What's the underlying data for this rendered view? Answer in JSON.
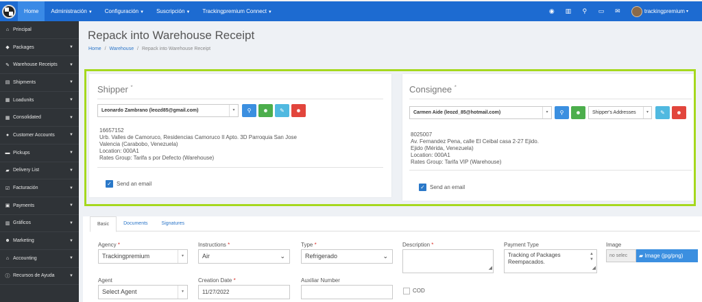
{
  "topbar": {
    "nav": [
      {
        "label": "Home",
        "active": true,
        "caret": false
      },
      {
        "label": "Administración",
        "active": false,
        "caret": true
      },
      {
        "label": "Configuración",
        "active": false,
        "caret": true
      },
      {
        "label": "Suscripción",
        "active": false,
        "caret": true
      },
      {
        "label": "Trackingpremium Connect",
        "active": false,
        "caret": true
      }
    ],
    "icons": [
      "globe-icon",
      "barcode-icon",
      "search-icon",
      "card-icon",
      "envelope-icon"
    ],
    "user": {
      "name": "trackingpremium",
      "caret": "▾"
    }
  },
  "sidebar": {
    "items": [
      {
        "label": "Principal",
        "icon": "home-icon",
        "glyph": "⌂",
        "arrow": false
      },
      {
        "label": "Packages",
        "icon": "tag-icon",
        "glyph": "◆",
        "arrow": true
      },
      {
        "label": "Warehouse Receipts",
        "icon": "edit-icon",
        "glyph": "✎",
        "arrow": true
      },
      {
        "label": "Shipments",
        "icon": "list-icon",
        "glyph": "▤",
        "arrow": true
      },
      {
        "label": "Loadunits",
        "icon": "table-icon",
        "glyph": "▦",
        "arrow": true
      },
      {
        "label": "Consolidated",
        "icon": "table-icon",
        "glyph": "▦",
        "arrow": true
      },
      {
        "label": "Customer Accounts",
        "icon": "marker-icon",
        "glyph": "●",
        "arrow": true
      },
      {
        "label": "Pickups",
        "icon": "car-icon",
        "glyph": "▬",
        "arrow": true
      },
      {
        "label": "Delivery List",
        "icon": "truck-icon",
        "glyph": "▰",
        "arrow": true
      },
      {
        "label": "Facturación",
        "icon": "check-icon",
        "glyph": "☑",
        "arrow": true
      },
      {
        "label": "Payments",
        "icon": "money-icon",
        "glyph": "▣",
        "arrow": true
      },
      {
        "label": "Gráficos",
        "icon": "chart-icon",
        "glyph": "▥",
        "arrow": true
      },
      {
        "label": "Marketing",
        "icon": "users-icon",
        "glyph": "☻",
        "arrow": true
      },
      {
        "label": "Accounting",
        "icon": "bank-icon",
        "glyph": "⌂",
        "arrow": true
      },
      {
        "label": "Recursos de Ayuda",
        "icon": "info-icon",
        "glyph": "ⓘ",
        "arrow": true
      }
    ]
  },
  "page": {
    "title": "Repack into Warehouse Receipt",
    "breadcrumb": [
      "Home",
      "Warehouse",
      "Repack into Warehouse Receipt"
    ],
    "breadcrumb_sep": "/"
  },
  "shipper": {
    "title": "Shipper",
    "required_mark": "*",
    "selected": "Leonardo Zambrano (leozd85@gmail.com)",
    "info_lines": [
      "16657152",
      "Urb. Valles de Camoruco, Residencias Camoruco II Apto. 3D Parroquia San Jose",
      "Valencia (Carabobo, Venezuela)",
      "Location: 000A1",
      "Rates Group: Tarifa s por Defecto (Warehouse)"
    ],
    "send_email": "Send an email"
  },
  "consignee": {
    "title": "Consignee",
    "required_mark": "*",
    "selected": "Carmen Aide (leozd_85@hotmail.com)",
    "address_select": "Shipper's Addresses",
    "info_lines": [
      "8025007",
      "Av. Fernandez Pena, calle El Ceibal casa 2-27 Ejido.",
      "Ejido (Mérida, Venezuela)",
      "Location: 000A1",
      "Rates Group: Tarifa VIP (Warehouse)"
    ],
    "send_email": "Send an email"
  },
  "tabs": [
    "Basic",
    "Documents",
    "Signatures"
  ],
  "form": {
    "agency_label": "Agency",
    "agency_value": "Trackingpremium",
    "instructions_label": "Instructions",
    "instructions_value": "Air",
    "type_label": "Type",
    "type_value": "Refrigerado",
    "description_label": "Description",
    "description_value": "",
    "payment_type_label": "Payment Type",
    "payment_type_value": "Tracking of Packages Reempacados.",
    "image_label": "Image",
    "image_file_placeholder": "no selec",
    "image_button": "Image (jpg/png)",
    "agent_label": "Agent",
    "agent_value": "Select Agent",
    "creation_date_label": "Creation Date",
    "creation_date_value": "11/27/2022",
    "auxiliar_label": "Auxiliar Number",
    "auxiliar_value": "",
    "cod_label": "COD",
    "required_mark": "*"
  },
  "colors": {
    "navbar": "#1d6bd1",
    "sidebar": "#2f3337",
    "highlight": "#a5d81d",
    "btn_blue": "#3b8fe0",
    "btn_green": "#4cae4c",
    "btn_cyan": "#50b9e0",
    "btn_red": "#e2453c"
  }
}
